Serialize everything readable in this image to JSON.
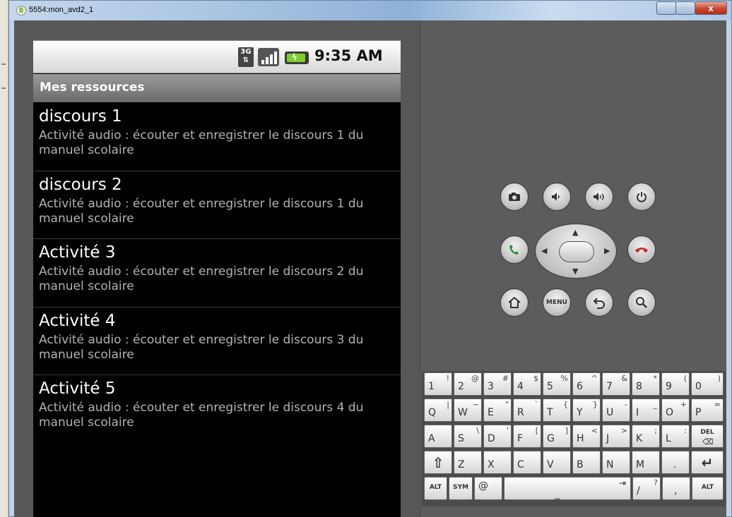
{
  "window": {
    "title": "5554:mon_avd2_1",
    "buttons": {
      "minimize": "−",
      "maximize": "▭",
      "close": "x"
    }
  },
  "status_bar": {
    "network": "3G",
    "time": "9:35 AM",
    "battery_color": "#7dcf2c"
  },
  "app": {
    "title": "Mes ressources"
  },
  "list": [
    {
      "title": "discours 1",
      "description": "Activité audio : écouter et enregistrer le discours 1 du manuel scolaire"
    },
    {
      "title": "discours 2",
      "description": "Activité audio : écouter et enregistrer le discours 1 du manuel scolaire"
    },
    {
      "title": "Activité 3",
      "description": "Activité audio : écouter et enregistrer le discours 2 du manuel scolaire"
    },
    {
      "title": "Activité 4",
      "description": "Activité audio : écouter et enregistrer le discours 3 du manuel scolaire"
    },
    {
      "title": "Activité 5",
      "description": "Activité audio : écouter et enregistrer le discours 4 du manuel scolaire"
    }
  ],
  "controls": {
    "row1": [
      "camera-icon",
      "volume-down-icon",
      "volume-up-icon",
      "power-icon"
    ],
    "call_color": "#2e8b2e",
    "end_call_color": "#cc2222",
    "menu_label": "MENU",
    "row3": [
      "home-icon",
      "menu-icon",
      "back-icon",
      "search-icon"
    ]
  },
  "keyboard": {
    "row1": [
      [
        "1",
        "!"
      ],
      [
        "2",
        "@"
      ],
      [
        "3",
        "#"
      ],
      [
        "4",
        "$"
      ],
      [
        "5",
        "%"
      ],
      [
        "6",
        "^"
      ],
      [
        "7",
        "&"
      ],
      [
        "8",
        "*"
      ],
      [
        "9",
        "("
      ],
      [
        "0",
        ")"
      ]
    ],
    "row2": [
      [
        "Q",
        "|"
      ],
      [
        "W",
        "~"
      ],
      [
        "E",
        "\""
      ],
      [
        "R",
        "`"
      ],
      [
        "T",
        "{"
      ],
      [
        "Y",
        "}"
      ],
      [
        "U",
        "-"
      ],
      [
        "I",
        "_"
      ],
      [
        "O",
        "+"
      ],
      [
        "P",
        "="
      ]
    ],
    "row3": [
      [
        "A",
        ""
      ],
      [
        "S",
        "\\"
      ],
      [
        "D",
        "'"
      ],
      [
        "F",
        "["
      ],
      [
        "G",
        "]"
      ],
      [
        "H",
        "<"
      ],
      [
        "J",
        ">"
      ],
      [
        "K",
        ";"
      ],
      [
        "L",
        ":"
      ]
    ],
    "row3_del": "DEL",
    "row4": [
      "Z",
      "X",
      "C",
      "V",
      "B",
      "N",
      "M",
      "."
    ],
    "row5": {
      "alt": "ALT",
      "sym": "SYM",
      "at": "@",
      "slash": "/",
      "slash_alt": "?",
      "comma": ","
    }
  }
}
